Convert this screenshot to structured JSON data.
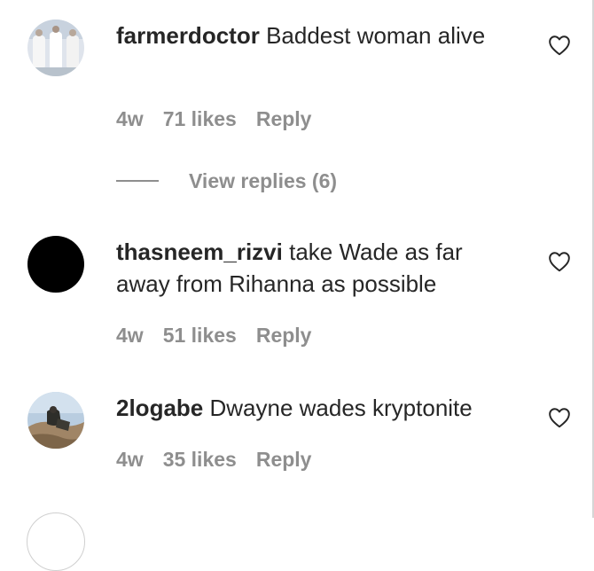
{
  "comments": [
    {
      "username": "farmerdoctor",
      "text": "Baddest woman alive",
      "time": "4w",
      "likes": "71 likes",
      "reply_label": "Reply",
      "avatar_icon": "farmerdoctor-avatar"
    },
    {
      "username": "thasneem_rizvi",
      "text": "take Wade as far away from Rihanna as possible",
      "time": "4w",
      "likes": "51 likes",
      "reply_label": "Reply",
      "avatar_icon": "thasneem-avatar"
    },
    {
      "username": "2logabe",
      "text": "Dwayne wades kryptonite",
      "time": "4w",
      "likes": "35 likes",
      "reply_label": "Reply",
      "avatar_icon": "2logabe-avatar"
    }
  ],
  "view_replies": {
    "label": "View replies (6)"
  },
  "icons": {
    "like": "heart-outline-icon"
  },
  "colors": {
    "text": "#262626",
    "muted": "#8e8e8e",
    "background": "#ffffff"
  }
}
